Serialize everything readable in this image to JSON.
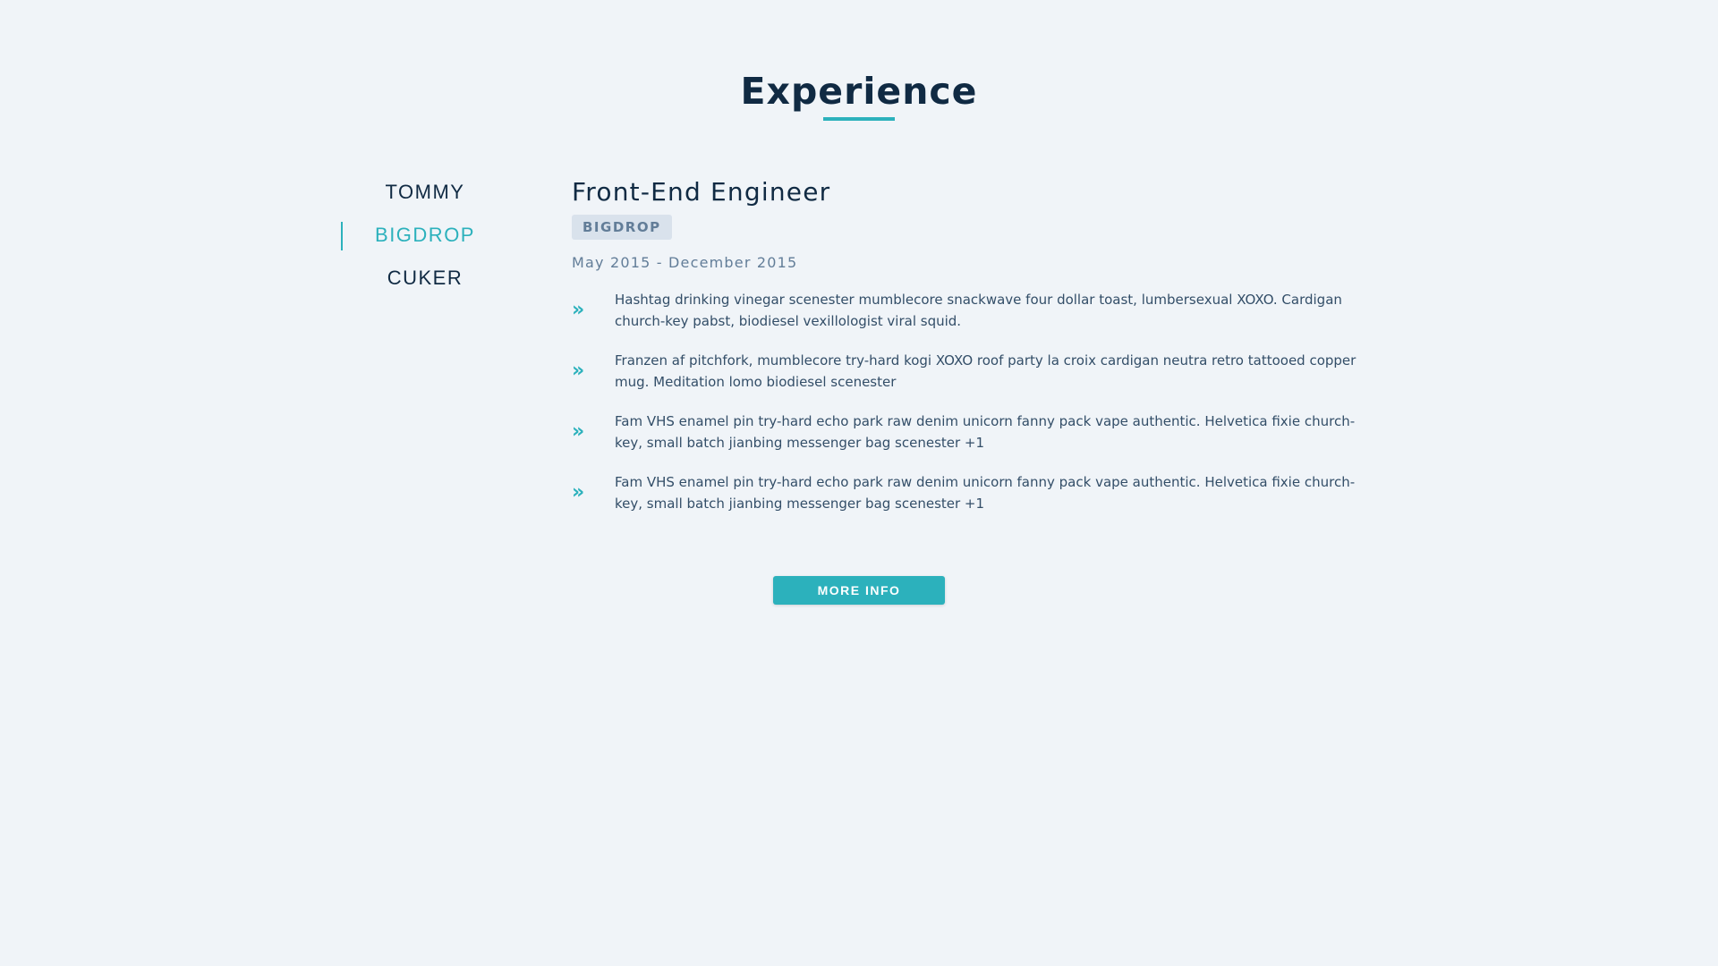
{
  "section": {
    "title": "Experience"
  },
  "companies": [
    {
      "label": "TOMMY",
      "active": false
    },
    {
      "label": "BIGDROP",
      "active": true
    },
    {
      "label": "CUKER",
      "active": false
    }
  ],
  "job": {
    "title": "Front-End Engineer",
    "company": "BIGDROP",
    "dates": "May 2015 - December 2015",
    "duties": [
      {
        "icon": "double-chevron-right-icon",
        "text": "Hashtag drinking vinegar scenester mumblecore snackwave four dollar toast, lumbersexual XOXO. Cardigan church-key pabst, biodiesel vexillologist viral squid."
      },
      {
        "icon": "double-chevron-right-icon",
        "text": "Franzen af pitchfork, mumblecore try-hard kogi XOXO roof party la croix cardigan neutra retro tattooed copper mug. Meditation lomo biodiesel scenester"
      },
      {
        "icon": "double-chevron-right-icon",
        "text": "Fam VHS enamel pin try-hard echo park raw denim unicorn fanny pack vape authentic. Helvetica fixie church-key, small batch jianbing messenger bag scenester +1"
      },
      {
        "icon": "double-chevron-right-icon",
        "text": "Fam VHS enamel pin try-hard echo park raw denim unicorn fanny pack vape authentic. Helvetica fixie church-key, small batch jianbing messenger bag scenester +1"
      }
    ]
  },
  "more_button": {
    "label": "MORE INFO"
  },
  "colors": {
    "background": "#f0f4f8",
    "accent": "#2cb1bc",
    "heading": "#102a43",
    "body_text": "#334e68",
    "muted": "#627d98",
    "badge_bg": "#d9e2ec"
  }
}
